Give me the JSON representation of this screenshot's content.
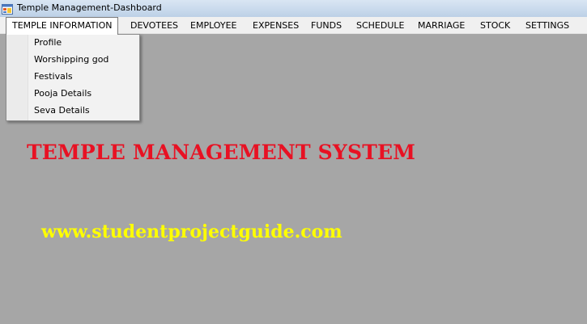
{
  "window": {
    "title": "Temple Management-Dashboard",
    "icon": "app-window-icon"
  },
  "menubar": {
    "items": [
      {
        "label": "TEMPLE INFORMATION"
      },
      {
        "label": "DEVOTEES"
      },
      {
        "label": "EMPLOYEE"
      },
      {
        "label": "EXPENSES"
      },
      {
        "label": "FUNDS"
      },
      {
        "label": "SCHEDULE"
      },
      {
        "label": "MARRIAGE"
      },
      {
        "label": "STOCK"
      },
      {
        "label": "SETTINGS"
      }
    ]
  },
  "dropdown": {
    "items": [
      {
        "label": "Profile"
      },
      {
        "label": "Worshipping god"
      },
      {
        "label": "Festivals"
      },
      {
        "label": "Pooja Details"
      },
      {
        "label": "Seva Details"
      }
    ]
  },
  "main": {
    "headline": "TEMPLE MANAGEMENT SYSTEM",
    "website": "www.studentprojectguide.com"
  },
  "colors": {
    "background": "#a6a6a6",
    "headline": "#e81123",
    "website": "#ffff00",
    "menubar": "#f0f0f0"
  }
}
